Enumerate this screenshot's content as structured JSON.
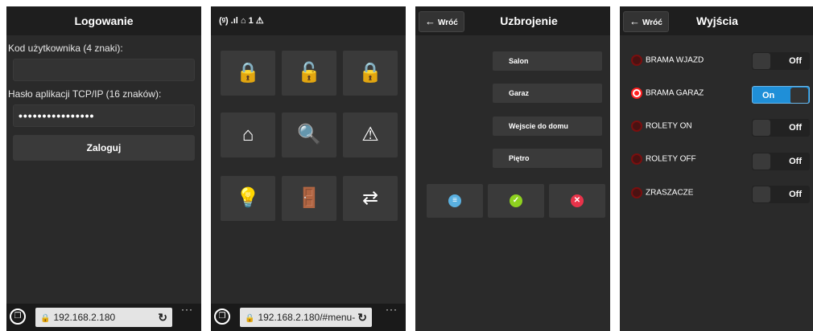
{
  "login": {
    "title": "Logowanie",
    "user_label": "Kod użytkownika (4 znaki):",
    "user_value": "",
    "password_label": "Hasło aplikacji TCP/IP (16 znaków):",
    "password_value": "••••••••••••••••",
    "submit_label": "Zaloguj",
    "url": "192.168.2.180"
  },
  "menu": {
    "status_text": "(ᵍ) .ıl  ⌂  1 ⚠",
    "url": "192.168.2.180/#menu-",
    "icons": [
      "red-lock-icon",
      "green-lock-icon",
      "purple-lock-icon",
      "house-search-icon",
      "document-search-icon",
      "warning-icon",
      "lightbulb-icon",
      "door-exit-icon",
      "document-transfer-icon"
    ]
  },
  "arming": {
    "back_label": "Wróć",
    "title": "Uzbrojenie",
    "zones": [
      "Salon",
      "Garaz",
      "Wejscie do domu",
      "Piętro"
    ],
    "actions": [
      "list-check-icon",
      "confirm-icon",
      "cancel-icon"
    ]
  },
  "outputs": {
    "back_label": "Wróć",
    "title": "Wyjścia",
    "items": [
      {
        "name": "BRAMA WJAZD",
        "state": "Off"
      },
      {
        "name": "BRAMA GARAZ",
        "state": "On"
      },
      {
        "name": "ROLETY ON",
        "state": "Off"
      },
      {
        "name": "ROLETY OFF",
        "state": "Off"
      },
      {
        "name": "ZRASZACZE",
        "state": "Off"
      }
    ]
  },
  "colors": {
    "accent": "#1f8fd8",
    "red": "#ff2020",
    "green": "#8ed11f",
    "purple": "#9a6bc8"
  }
}
